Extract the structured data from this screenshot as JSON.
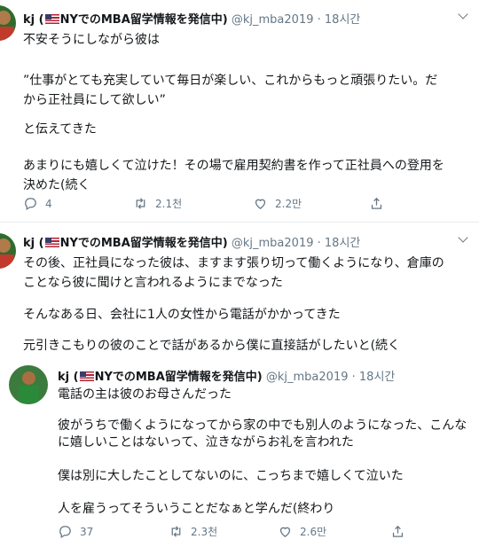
{
  "tweets": [
    {
      "display_name": "kj (",
      "display_name_rest": "NYでのMBA留学情報を発信中)",
      "handle": "@kj_mba2019",
      "dot": "·",
      "time": "18시간",
      "lines": [
        "不安そうにしながら彼は",
        "",
        "”仕事がとても充実していて毎日が楽しい、これからもっと頑張りたい。だ",
        "から正社員にして欲しい”",
        "",
        "と伝えてきた",
        "",
        "あまりにも嬉しくて泣けた！その場で雇用契約書を作って正社員への登用を",
        "決めた(続く"
      ],
      "replies": "4",
      "retweets": "2.1천",
      "likes": "2.2만"
    },
    {
      "display_name": "kj (",
      "display_name_rest": "NYでのMBA留学情報を発信中)",
      "handle": "@kj_mba2019",
      "dot": "·",
      "time": "18시간",
      "lines": [
        "その後、正社員になった彼は、ますます張り切って働くようになり、倉庫の",
        "ことなら彼に聞けと言われるようにまでなった",
        "",
        "そんなある日、会社に1人の女性から電話がかかってきた",
        "",
        "元引きこもりの彼のことで話があるから僕に直接話がしたいと(続く"
      ]
    },
    {
      "display_name": "kj (",
      "display_name_rest": "NYでのMBA留学情報を発信中)",
      "handle": "@kj_mba2019",
      "dot": "·",
      "time": "18시간",
      "lines": [
        "電話の主は彼のお母さんだった",
        "",
        "彼がうちで働くようになってから家の中でも別人のようになった、こんな",
        "に嬉しいことはないって、泣きながらお礼を言われた",
        "",
        "僕は別に大したことしてないのに、こっちまで嬉しくて泣いた",
        "",
        "人を雇うってそういうことだなぁと学んだ(終わり"
      ],
      "replies": "37",
      "retweets": "2.3천",
      "likes": "2.6만"
    }
  ],
  "icons": [
    "reply-icon",
    "retweet-icon",
    "like-icon",
    "share-icon",
    "more-caret-icon",
    "us-flag-icon",
    "avatar"
  ],
  "colors": {
    "text": "#14171a",
    "secondary": "#657786",
    "divider": "#e6ecf0",
    "background": "#ffffff"
  }
}
